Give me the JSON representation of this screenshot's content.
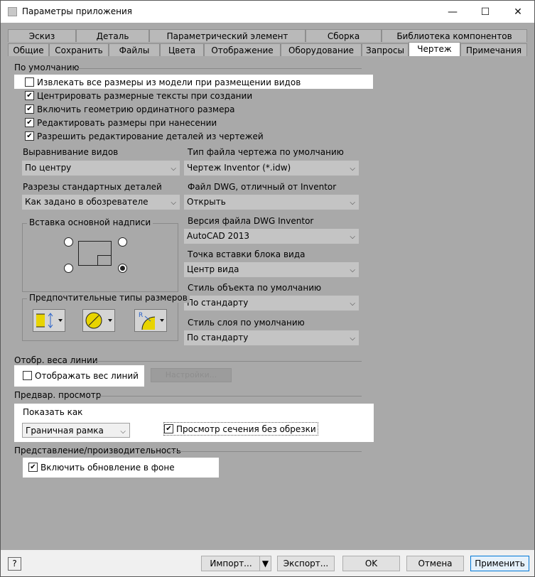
{
  "window": {
    "title": "Параметры приложения",
    "minimize": "—",
    "maximize": "☐",
    "close": "✕"
  },
  "tabs": {
    "row1": [
      "Эскиз",
      "Деталь",
      "Параметрический элемент",
      "Сборка",
      "Библиотека компонентов"
    ],
    "row2": [
      "Общие",
      "Сохранить",
      "Файлы",
      "Цвета",
      "Отображение",
      "Оборудование",
      "Запросы",
      "Чертеж",
      "Примечания"
    ],
    "active": "Чертеж"
  },
  "defaults": {
    "section": "По умолчанию",
    "checkboxes": [
      {
        "label": "Извлекать все размеры из модели при размещении видов",
        "checked": false
      },
      {
        "label": "Центрировать размерные тексты при создании",
        "checked": true
      },
      {
        "label": "Включить геометрию ординатного размера",
        "checked": true
      },
      {
        "label": "Редактировать размеры при нанесении",
        "checked": true
      },
      {
        "label": "Разрешить редактирование деталей из чертежей",
        "checked": true
      }
    ],
    "view_align": {
      "label": "Выравнивание видов",
      "value": "По центру"
    },
    "std_sections": {
      "label": "Разрезы стандартных деталей",
      "value": "Как задано в обозревателе"
    },
    "file_type": {
      "label": "Тип файла чертежа по умолчанию",
      "value": "Чертеж Inventor (*.idw)"
    },
    "dwg_non_inventor": {
      "label": "Файл DWG, отличный от Inventor",
      "value": "Открыть"
    },
    "dwg_version": {
      "label": "Версия файла DWG Inventor",
      "value": "AutoCAD 2013"
    },
    "insert_point": {
      "label": "Точка вставки блока вида",
      "value": "Центр вида"
    },
    "object_style": {
      "label": "Стиль объекта по умолчанию",
      "value": "По стандарту"
    },
    "layer_style": {
      "label": "Стиль слоя по умолчанию",
      "value": "По стандарту"
    },
    "title_block": {
      "label": "Вставка основной надписи"
    },
    "dim_types": {
      "label": "Предпочтительные типы размеров"
    }
  },
  "lineweight": {
    "section": "Отобр. веса линии",
    "checkbox": "Отображать вес линий",
    "checked": false,
    "button": "Настройки..."
  },
  "preview": {
    "section": "Предвар. просмотр",
    "show_as_label": "Показать как",
    "show_as_value": "Граничная рамка",
    "section_checkbox": "Просмотр сечения без обрезки",
    "section_checked": true
  },
  "performance": {
    "section": "Представление/производительность",
    "checkbox": "Включить обновление в фоне",
    "checked": true
  },
  "buttons": {
    "help": "?",
    "import": "Импорт...",
    "export": "Экспорт...",
    "ok": "OK",
    "cancel": "Отмена",
    "apply": "Применить"
  },
  "colors": {
    "accent": "#0078d7",
    "panel": "#a9a9a9"
  }
}
